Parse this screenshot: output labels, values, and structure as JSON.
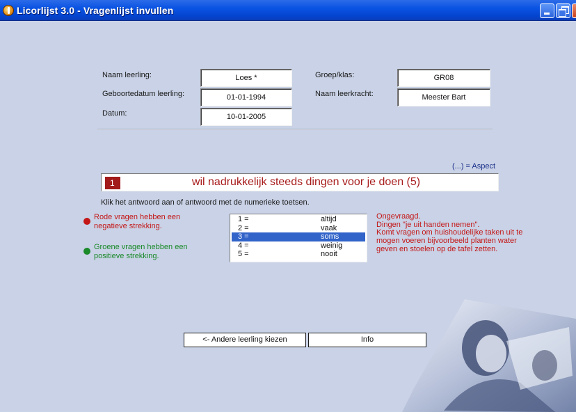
{
  "window": {
    "title": "Licorlijst 3.0 - Vragenlijst invullen"
  },
  "form": {
    "student_name_label": "Naam leerling:",
    "student_name_value": "Loes *",
    "birthdate_label": "Geboortedatum leerling:",
    "birthdate_value": "01-01-1994",
    "date_label": "Datum:",
    "date_value": "10-01-2005",
    "group_label": "Groep/klas:",
    "group_value": "GR08",
    "teacher_label": "Naam leerkracht:",
    "teacher_value": "Meester Bart"
  },
  "aspect_hint": "(...) = Aspect",
  "question": {
    "number": "1",
    "text": "wil nadrukkelijk steeds dingen voor je doen (5)"
  },
  "instruction": "Klik het antwoord aan of antwoord met de numerieke toetsen.",
  "legend": {
    "red_text": "Rode vragen hebben een negatieve strekking.",
    "green_text": "Groene vragen hebben een positieve strekking.",
    "red_color": "#c41717",
    "green_color": "#1a8a2a"
  },
  "answers": [
    {
      "num": "1 =",
      "word": "altijd",
      "selected": false
    },
    {
      "num": "2 =",
      "word": "vaak",
      "selected": false
    },
    {
      "num": "3 =",
      "word": "soms",
      "selected": true
    },
    {
      "num": "4 =",
      "word": "weinig",
      "selected": false
    },
    {
      "num": "5 =",
      "word": "nooit",
      "selected": false
    }
  ],
  "aspect_description": "Ongevraagd.\nDingen \"je uit handen nemen\".\nKomt vragen om huishoudelijke taken uit te mogen voeren bijvoorbeeld planten water geven en stoelen op de tafel zetten.",
  "buttons": {
    "other_student": "<- Andere leerling kiezen",
    "info": "Info"
  },
  "colors": {
    "background": "#c9d2e6",
    "question_accent": "#a31a1a",
    "selection": "#3163c9"
  }
}
